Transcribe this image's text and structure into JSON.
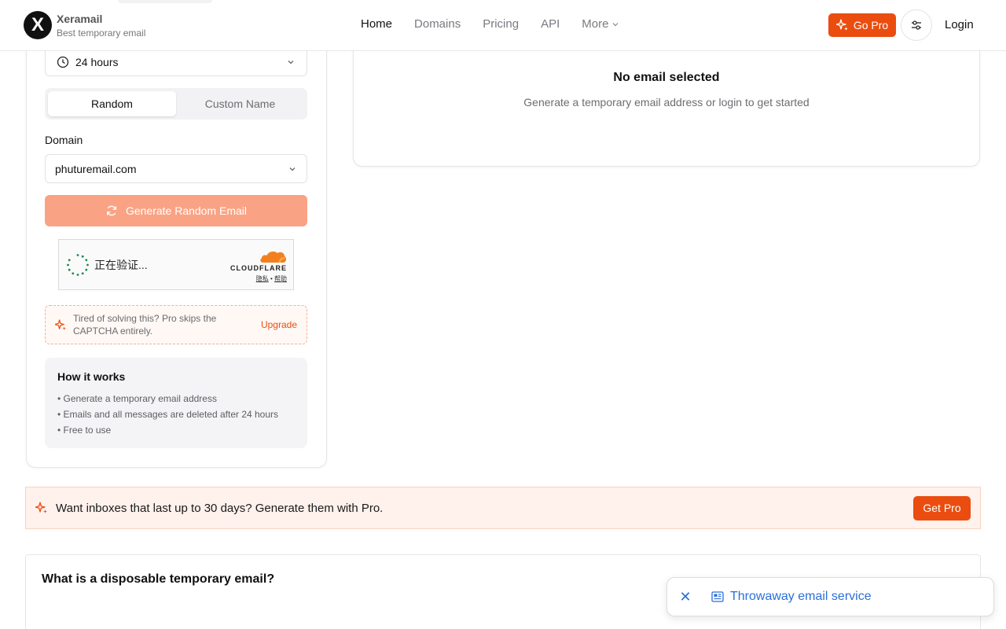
{
  "brand": {
    "logo_letter": "X",
    "name": "Xeramail",
    "tagline": "Best temporary email"
  },
  "nav": {
    "items": [
      {
        "label": "Home"
      },
      {
        "label": "Domains"
      },
      {
        "label": "Pricing"
      },
      {
        "label": "API"
      },
      {
        "label": "More"
      }
    ],
    "go_pro": "Go Pro",
    "login": "Login"
  },
  "generator": {
    "duration": "24 hours",
    "modes": [
      "Random",
      "Custom Name"
    ],
    "domain_label": "Domain",
    "domain_value": "phuturemail.com",
    "generate_label": "Generate Random Email"
  },
  "captcha": {
    "status": "正在验证...",
    "brand": "CLOUDFLARE",
    "privacy": "隐私",
    "separator": "•",
    "help": "帮助"
  },
  "upsell": {
    "text": "Tired of solving this? Pro skips the CAPTCHA entirely.",
    "link": "Upgrade"
  },
  "how": {
    "title": "How it works",
    "items": [
      "• Generate a temporary email address",
      "• Emails and all messages are deleted after 24 hours",
      "• Free to use"
    ]
  },
  "inbox": {
    "title": "No email selected",
    "subtitle": "Generate a temporary email address or login to get started"
  },
  "pro_banner": {
    "text": "Want inboxes that last up to 30 days? Generate them with Pro.",
    "button": "Get Pro"
  },
  "faq": {
    "title": "What is a disposable temporary email?"
  },
  "toast": {
    "close": "✕",
    "text": "Throwaway email service"
  },
  "colors": {
    "accent": "#ea4d0f",
    "accent_light": "#f9a384",
    "banner_bg": "#fff1ec",
    "link_blue": "#2a6fdb",
    "cloudflare": "#f38020"
  },
  "icons": {
    "duration": "clock-icon",
    "chevron": "chevron-down-icon",
    "generate": "refresh-icon",
    "pro": "sparkles-icon",
    "settings": "sliders-icon",
    "toast_close": "close-icon",
    "toast_doc": "newspaper-icon"
  }
}
